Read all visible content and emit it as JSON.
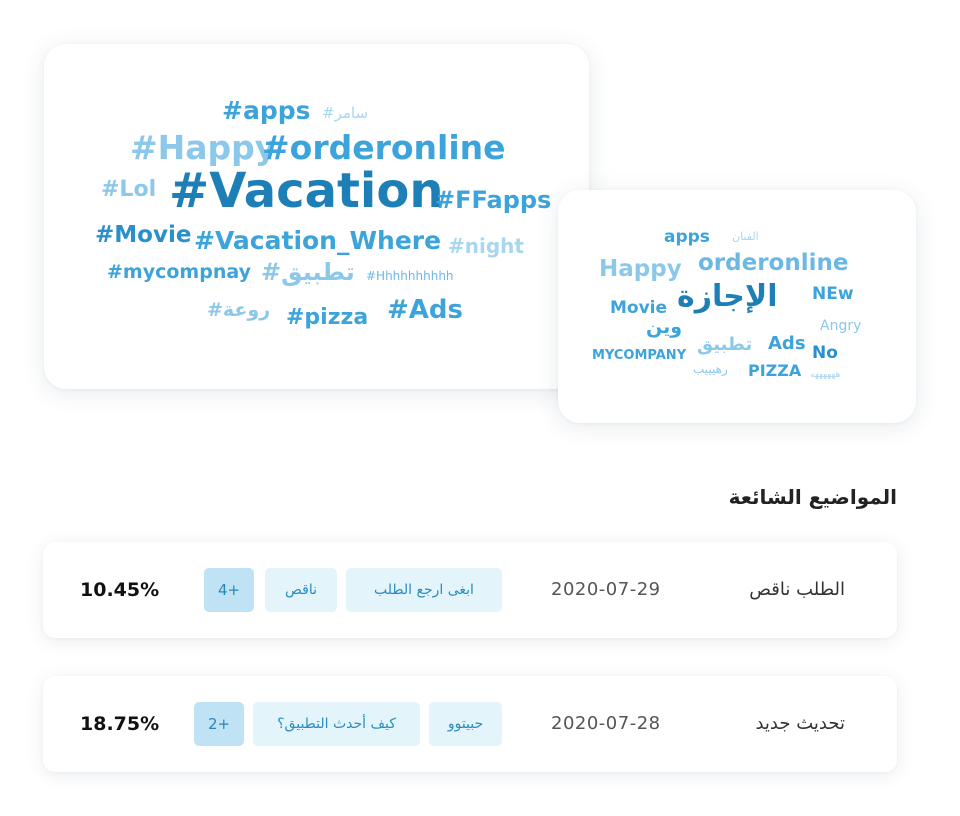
{
  "colors": {
    "dark": "#1e7fb6",
    "mid": "#3da3db",
    "light": "#8cc8ea",
    "chip_bg": "#e3f4fb",
    "chip_count_bg": "#bfe3f4"
  },
  "word_cloud_large": {
    "w1": "#apps",
    "w2": "#سامر",
    "w3": "#Happy",
    "w4": "#orderonline",
    "w5": "#Lol",
    "w6": "#Vacation",
    "w7": "#FFapps",
    "w8": "#Movie",
    "w9": "#Vacation_Where",
    "w10": "#night",
    "w11": "#mycompnay",
    "w12": "#تطبيق",
    "w13": "#Hhhhhhhhhh",
    "w14": "#روعة",
    "w15": "#pizza",
    "w16": "#Ads"
  },
  "word_cloud_small": {
    "w1": "apps",
    "w2": "الفنان",
    "w3": "Happy",
    "w4": "orderonline",
    "w5": "Movie",
    "w6": "الإجازة",
    "w7": "NEw",
    "w8": "Angry",
    "w9": "وين",
    "w10": "MYCOMPANY",
    "w11": "تطبيق",
    "w12": "Ads",
    "w13": "No",
    "w14": "رهيييب",
    "w15": "PIZZA",
    "w16": "ههههههه"
  },
  "trending": {
    "title": "المواضيع الشائعة",
    "rows": [
      {
        "name": "الطلب ناقص",
        "date": "2020-07-29",
        "tags": [
          "ابغى ارجع الطلب",
          "ناقص"
        ],
        "more": "+4",
        "percent": "10.45%"
      },
      {
        "name": "تحديث جديد",
        "date": "2020-07-28",
        "tags": [
          "حبيتوو",
          "كيف أحدث التطبيق؟"
        ],
        "more": "+2",
        "percent": "18.75%"
      }
    ]
  }
}
